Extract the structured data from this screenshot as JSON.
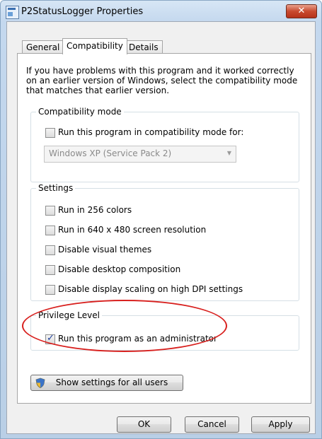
{
  "window": {
    "title": "P2StatusLogger Properties",
    "close_icon": "close-icon",
    "close_symbol": "✕"
  },
  "tabs": [
    {
      "label": "General",
      "active": false
    },
    {
      "label": "Compatibility",
      "active": true
    },
    {
      "label": "Details",
      "active": false
    }
  ],
  "intro_text": "If you have problems with this program and it worked correctly on an earlier version of Windows, select the compatibility mode that matches that earlier version.",
  "compatibility_mode": {
    "label": "Compatibility mode",
    "checkbox_label": "Run this program in compatibility mode for:",
    "checked": false,
    "select_value": "Windows XP (Service Pack 2)"
  },
  "settings": {
    "label": "Settings",
    "items": [
      {
        "label": "Run in 256 colors",
        "checked": false
      },
      {
        "label": "Run in 640 x 480 screen resolution",
        "checked": false
      },
      {
        "label": "Disable visual themes",
        "checked": false
      },
      {
        "label": "Disable desktop composition",
        "checked": false
      },
      {
        "label": "Disable display scaling on high DPI settings",
        "checked": false
      }
    ]
  },
  "privilege": {
    "label": "Privilege Level",
    "checkbox_label": "Run this program as an administrator",
    "checked": true
  },
  "show_settings_button": "Show settings for all users",
  "buttons": {
    "ok": "OK",
    "cancel": "Cancel",
    "apply": "Apply"
  },
  "colors": {
    "highlight": "#d8201e",
    "close": "#c84a2f"
  }
}
